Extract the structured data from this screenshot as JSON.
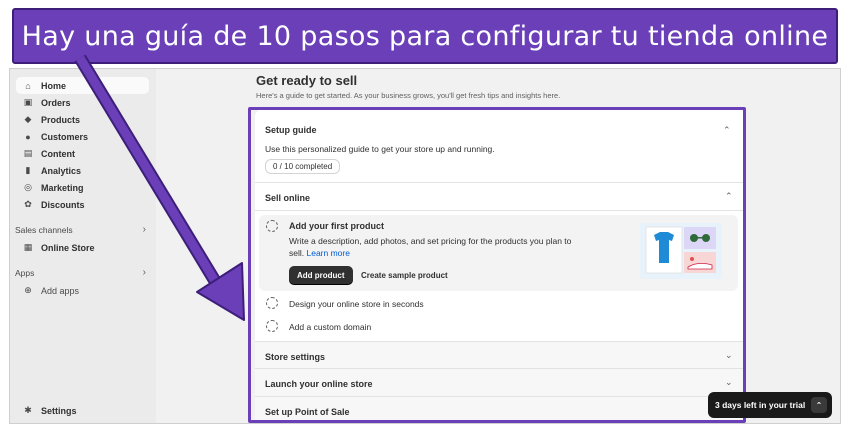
{
  "banner": {
    "text": "Hay una guía de 10 pasos para configurar tu tienda online"
  },
  "sidebar": {
    "items": [
      {
        "label": "Home",
        "icon": "home-icon"
      },
      {
        "label": "Orders",
        "icon": "inbox-icon"
      },
      {
        "label": "Products",
        "icon": "tag-icon"
      },
      {
        "label": "Customers",
        "icon": "person-icon"
      },
      {
        "label": "Content",
        "icon": "image-icon"
      },
      {
        "label": "Analytics",
        "icon": "bar-chart-icon"
      },
      {
        "label": "Marketing",
        "icon": "target-icon"
      },
      {
        "label": "Discounts",
        "icon": "discount-icon"
      }
    ],
    "sales_channels_label": "Sales channels",
    "online_store_label": "Online Store",
    "apps_label": "Apps",
    "add_apps_label": "Add apps",
    "settings_label": "Settings"
  },
  "main": {
    "title": "Get ready to sell",
    "subtitle": "Here's a guide to get started. As your business grows, you'll get fresh tips and insights here."
  },
  "setup_guide": {
    "title": "Setup guide",
    "description": "Use this personalized guide to get your store up and running.",
    "progress": "0 / 10 completed",
    "progress_fraction": 0,
    "sections": {
      "sell_online": "Sell online",
      "store_settings": "Store settings",
      "launch": "Launch your online store",
      "pos": "Set up Point of Sale"
    },
    "step_first_product": {
      "title": "Add your first product",
      "description_line1": "Write a description, add photos, and set pricing for the products you plan to",
      "description_line2": "sell.",
      "learn_more": "Learn more",
      "primary_button": "Add product",
      "secondary_button": "Create sample product"
    },
    "step_design": "Design your online store in seconds",
    "step_domain": "Add a custom domain"
  },
  "toast": {
    "text": "3 days left in your trial"
  },
  "colors": {
    "accent": "#6a3fb8",
    "link": "#005bd3"
  }
}
